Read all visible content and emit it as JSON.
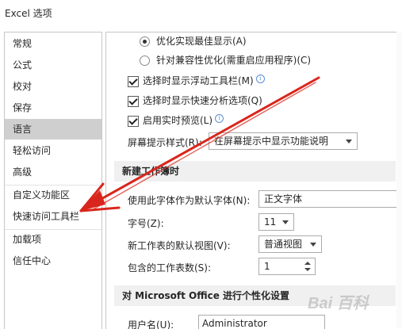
{
  "window": {
    "title": "Excel 选项"
  },
  "sidebar": {
    "items": [
      {
        "label": "常规",
        "selected": false
      },
      {
        "label": "公式",
        "selected": false
      },
      {
        "label": "校对",
        "selected": false
      },
      {
        "label": "保存",
        "selected": false
      },
      {
        "label": "语言",
        "selected": true
      },
      {
        "label": "轻松访问",
        "selected": false
      },
      {
        "label": "高级",
        "selected": false
      },
      {
        "label": "自定义功能区",
        "selected": false
      },
      {
        "label": "快速访问工具栏",
        "selected": false
      },
      {
        "label": "加载项",
        "selected": false
      },
      {
        "label": "信任中心",
        "selected": false
      }
    ]
  },
  "display": {
    "radio_best_display": "优化实现最佳显示(A)",
    "radio_compat": "针对兼容性优化(需重启应用程序)(C)",
    "check_mini_toolbar": "选择时显示浮动工具栏(M)",
    "check_quick_analysis": "选择时显示快速分析选项(Q)",
    "check_live_preview": "启用实时预览(L)",
    "screentip_label": "屏幕提示样式(R):",
    "screentip_value": "在屏幕提示中显示功能说明"
  },
  "new_workbook": {
    "header": "新建工作簿时",
    "font_label": "使用此字体作为默认字体(N):",
    "font_value": "正文字体",
    "size_label": "字号(Z):",
    "size_value": "11",
    "view_label": "新工作表的默认视图(V):",
    "view_value": "普通视图",
    "sheets_label": "包含的工作表数(S):",
    "sheets_value": "1"
  },
  "personalize": {
    "header": "对 Microsoft Office 进行个性化设置",
    "username_label": "用户名(U):",
    "username_value": "Administrator"
  },
  "watermark": "Bai 百科",
  "colors": {
    "selected_bg": "#cfcfcf",
    "arrow": "#d9261c",
    "section_bg": "#f0f0f0"
  }
}
